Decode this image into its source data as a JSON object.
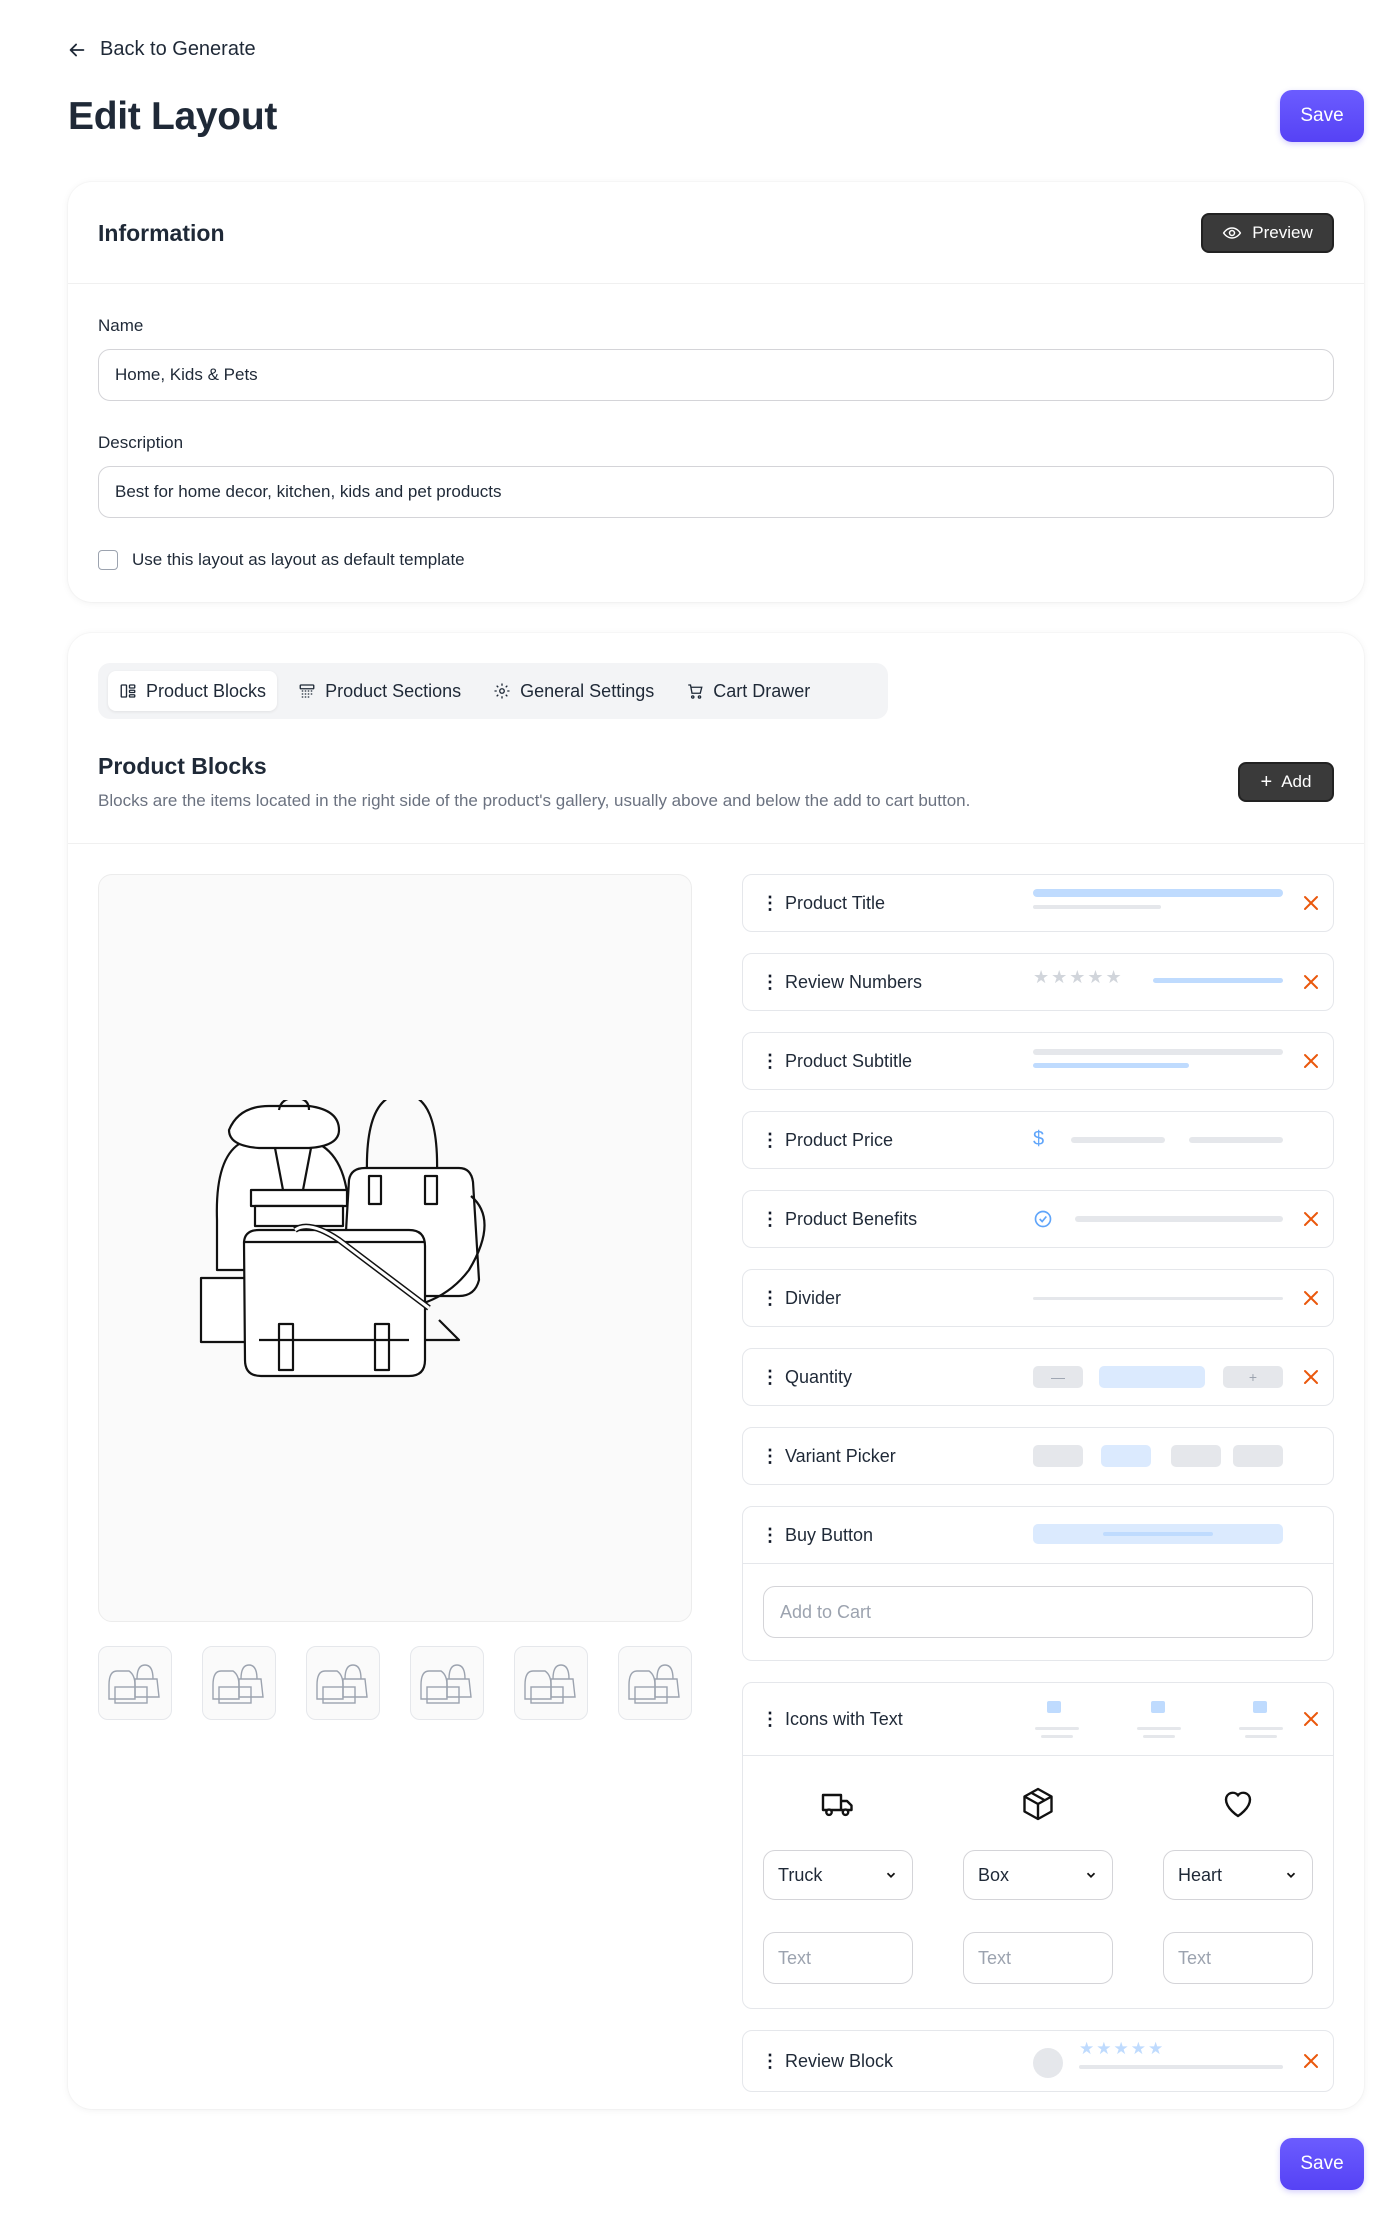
{
  "header": {
    "back_label": "Back to Generate",
    "title": "Edit Layout",
    "save_label": "Save"
  },
  "information": {
    "title": "Information",
    "preview_label": "Preview",
    "name_label": "Name",
    "name_value": "Home, Kids & Pets",
    "description_label": "Description",
    "description_value": "Best for home decor, kitchen, kids and pet products",
    "default_checkbox_label": "Use this layout as layout as default template",
    "default_checked": false
  },
  "tabs": [
    {
      "label": "Product Blocks",
      "icon": "blocks-icon",
      "active": true
    },
    {
      "label": "Product Sections",
      "icon": "sections-icon",
      "active": false
    },
    {
      "label": "General Settings",
      "icon": "gear-icon",
      "active": false
    },
    {
      "label": "Cart Drawer",
      "icon": "cart-icon",
      "active": false
    }
  ],
  "product_blocks": {
    "title": "Product Blocks",
    "description": "Blocks are the items located in the right side of the product's gallery, usually above and below the add to cart button.",
    "add_label": "Add",
    "blocks": [
      {
        "name": "Product Title"
      },
      {
        "name": "Review Numbers"
      },
      {
        "name": "Product Subtitle"
      },
      {
        "name": "Product Price"
      },
      {
        "name": "Product Benefits"
      },
      {
        "name": "Divider"
      },
      {
        "name": "Quantity"
      },
      {
        "name": "Variant Picker"
      },
      {
        "name": "Buy Button",
        "input_placeholder": "Add to Cart"
      },
      {
        "name": "Icons with Text",
        "items": [
          {
            "icon": "truck-icon",
            "select": "Truck",
            "text_placeholder": "Text"
          },
          {
            "icon": "box-icon",
            "select": "Box",
            "text_placeholder": "Text"
          },
          {
            "icon": "heart-icon",
            "select": "Heart",
            "text_placeholder": "Text"
          }
        ]
      },
      {
        "name": "Review Block"
      }
    ]
  },
  "colors": {
    "accent": "#5b4af7",
    "dark_button": "#3a3a3a",
    "remove": "#ea580c",
    "preview_blue": "#bfdbfe",
    "preview_gray": "#e5e7eb"
  },
  "gallery": {
    "image": "bags-illustration",
    "thumbnail_count": 6
  },
  "footer": {
    "save_label": "Save"
  }
}
